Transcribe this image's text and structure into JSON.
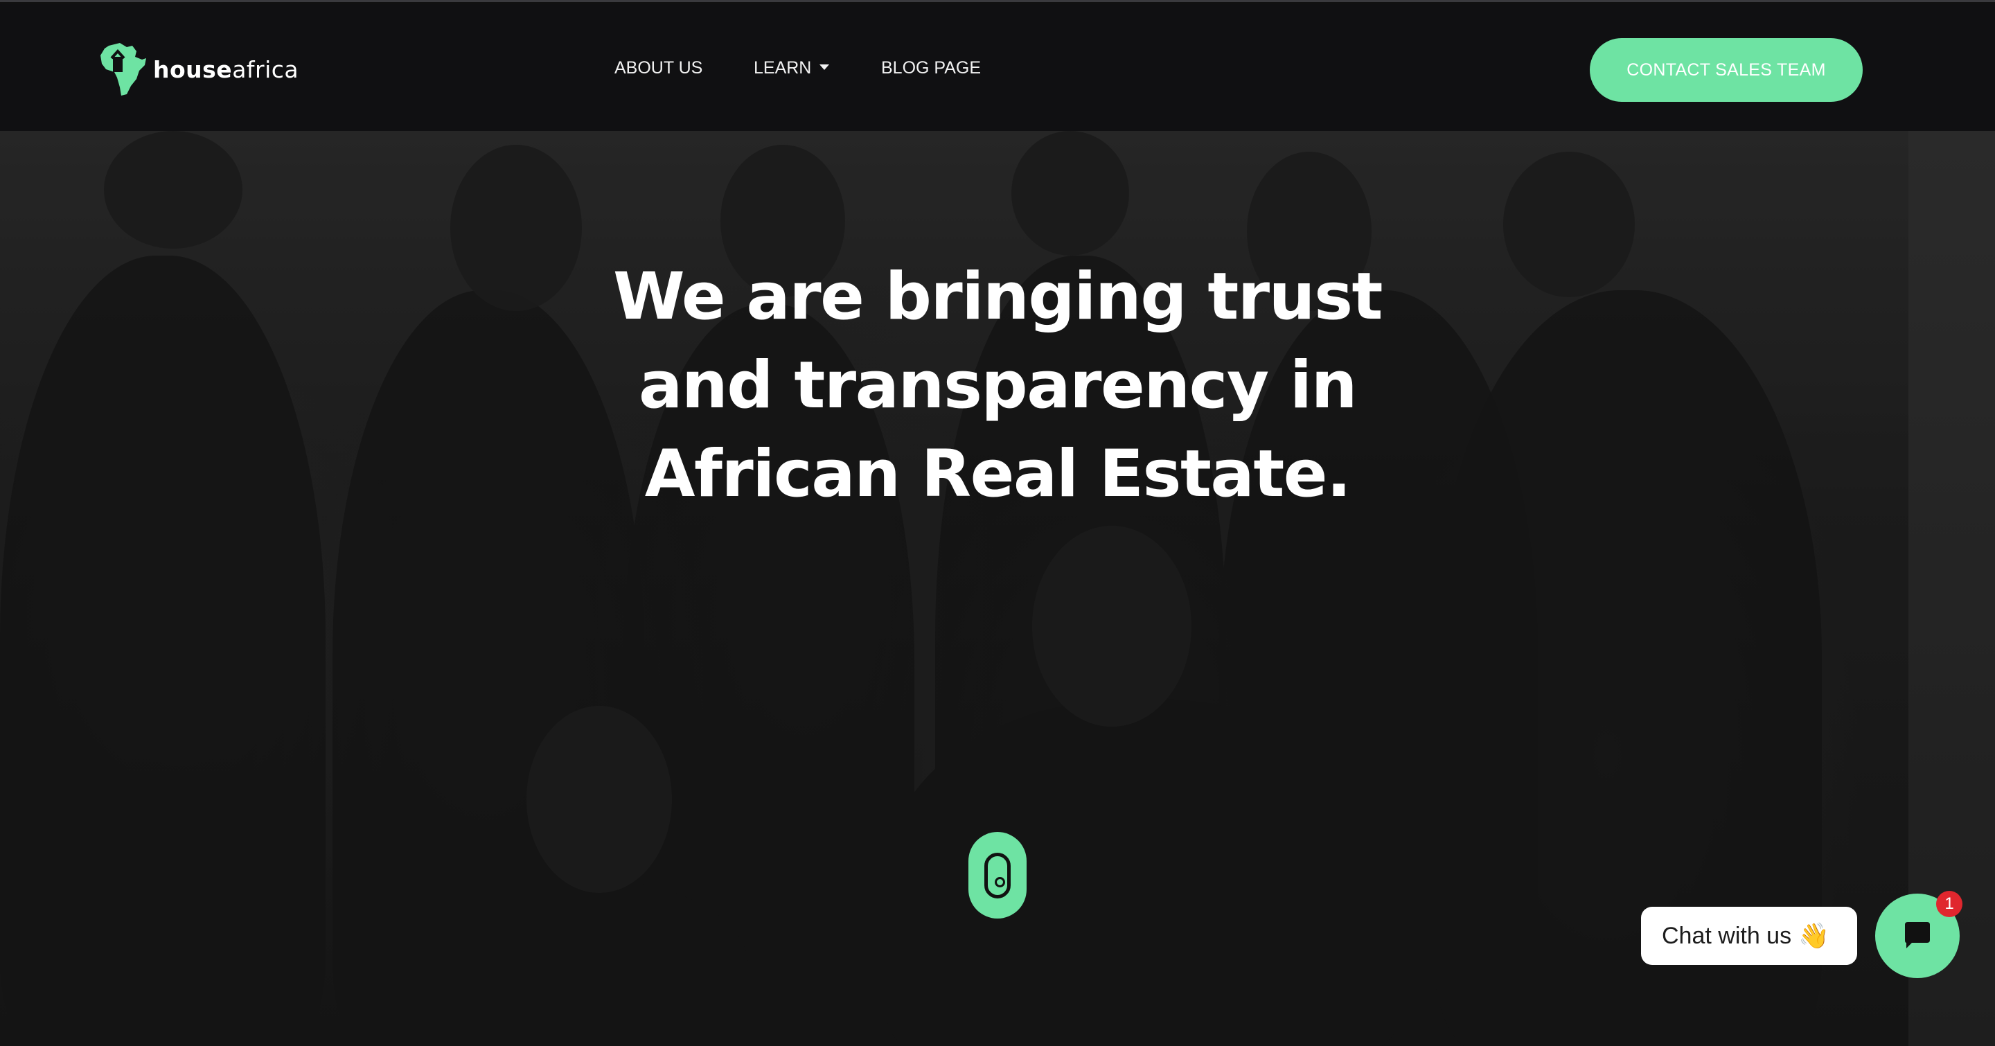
{
  "brand": {
    "logo_bold": "house",
    "logo_light": "africa",
    "accent_color": "#6ee3a3",
    "header_bg": "#101012"
  },
  "nav": {
    "about": "ABOUT US",
    "learn": "LEARN",
    "blog": "BLOG PAGE",
    "cta": "CONTACT SALES TEAM"
  },
  "hero": {
    "headline_line1": "We are bringing trust",
    "headline_line2": "and transparency in",
    "headline_line3": "African Real Estate.",
    "scroll_icon": "mouse-scroll-icon"
  },
  "chat": {
    "label": "Chat with us",
    "emoji": "👋",
    "unread_count": "1",
    "icon": "chat-icon"
  }
}
